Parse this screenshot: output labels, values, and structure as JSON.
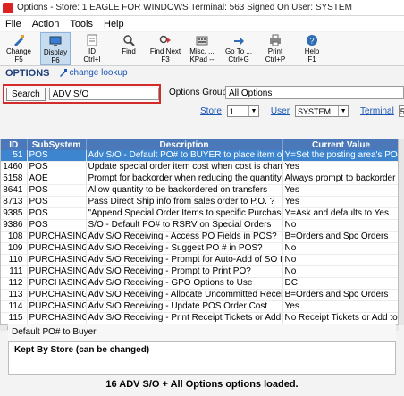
{
  "window": {
    "title": "Options - Store: 1   EAGLE FOR WINDOWS   Terminal: 563   Signed On User: SYSTEM"
  },
  "menu": [
    "File",
    "Action",
    "Tools",
    "Help"
  ],
  "toolbar": [
    {
      "icon": "change-icon",
      "line1": "Change",
      "line2": "F5"
    },
    {
      "icon": "display-icon",
      "line1": "Display",
      "line2": "F6"
    },
    {
      "icon": "id-icon",
      "line1": "ID",
      "line2": "Ctrl+I"
    },
    {
      "icon": "find-icon",
      "line1": "Find",
      "line2": ""
    },
    {
      "icon": "find-next-icon",
      "line1": "Find Next",
      "line2": "F3"
    },
    {
      "icon": "misc-icon",
      "line1": "Misc. ...",
      "line2": "KPad --"
    },
    {
      "icon": "goto-icon",
      "line1": "Go To ...",
      "line2": "Ctrl+G"
    },
    {
      "icon": "print-icon",
      "line1": "Print",
      "line2": "Ctrl+P"
    },
    {
      "icon": "help-icon",
      "line1": "Help",
      "line2": "F1"
    }
  ],
  "header": {
    "title": "OPTIONS",
    "change_lookup": "change lookup"
  },
  "search": {
    "label": "Search",
    "value": "ADV S/O"
  },
  "options_group": {
    "label": "Options Group",
    "value": "All Options"
  },
  "filters": {
    "store_label": "Store",
    "store_value": "1",
    "user_label": "User",
    "user_value": "SYSTEM",
    "terminal_label": "Terminal",
    "terminal_value": "56"
  },
  "columns": [
    "ID",
    "SubSystem",
    "Description",
    "Current Value"
  ],
  "rows": [
    [
      "51",
      "POS",
      "Adv S/O - Default PO# to BUYER to place item on Buy",
      "Y=Set the posting area's PO#"
    ],
    [
      "1460",
      "POS",
      "Update special order item cost when cost is changed i",
      "Yes"
    ],
    [
      "5158",
      "AOE",
      "Prompt for backorder when reducing the quantity on or",
      "Always prompt to backorder t"
    ],
    [
      "8641",
      "POS",
      "Allow quantity to be backordered on transfers",
      "Yes"
    ],
    [
      "8713",
      "POS",
      "Pass Direct Ship info from sales order to P.O. ?",
      "Yes"
    ],
    [
      "9385",
      "POS",
      "\"Append Special Order Items to specific Purchase Ord",
      "Y=Ask and defaults to Yes"
    ],
    [
      "9386",
      "POS",
      "S/O - Default PO# to RSRV on Special Orders",
      "No"
    ],
    [
      "108",
      "PURCHASING",
      "Adv S/O Receiving - Access PO Fields in POS?",
      "B=Orders and Spc Orders"
    ],
    [
      "109",
      "PURCHASING",
      "Adv S/O Receiving - Suggest PO # in POS?",
      "No"
    ],
    [
      "110",
      "PURCHASING",
      "Adv S/O Receiving - Prompt for Auto-Add of SO Items",
      "No"
    ],
    [
      "111",
      "PURCHASING",
      "Adv S/O Receiving - Prompt to Print PO?",
      "No"
    ],
    [
      "112",
      "PURCHASING",
      "Adv S/O Receiving - GPO Options to Use",
      "DC"
    ],
    [
      "113",
      "PURCHASING",
      "Adv S/O Receiving - Allocate Uncommitted Receipts to",
      "B=Orders and Spc Orders"
    ],
    [
      "114",
      "PURCHASING",
      "Adv S/O Receiving - Update POS Order Cost",
      "Yes"
    ],
    [
      "115",
      "PURCHASING",
      "Adv S/O Receiving - Print Receipt Tickets or Add to Ba",
      "No Receipt Tickets or Add to"
    ]
  ],
  "description_panel": "Default PO# to Buyer",
  "detail": "Kept By Store (can be changed)",
  "status": "16 ADV S/O + All Options options loaded.",
  "colors": {
    "header_bg": "#4a78b8",
    "selected_bg": "#3d86cf",
    "search_border": "#d42a2a",
    "link": "#1a56b4"
  }
}
